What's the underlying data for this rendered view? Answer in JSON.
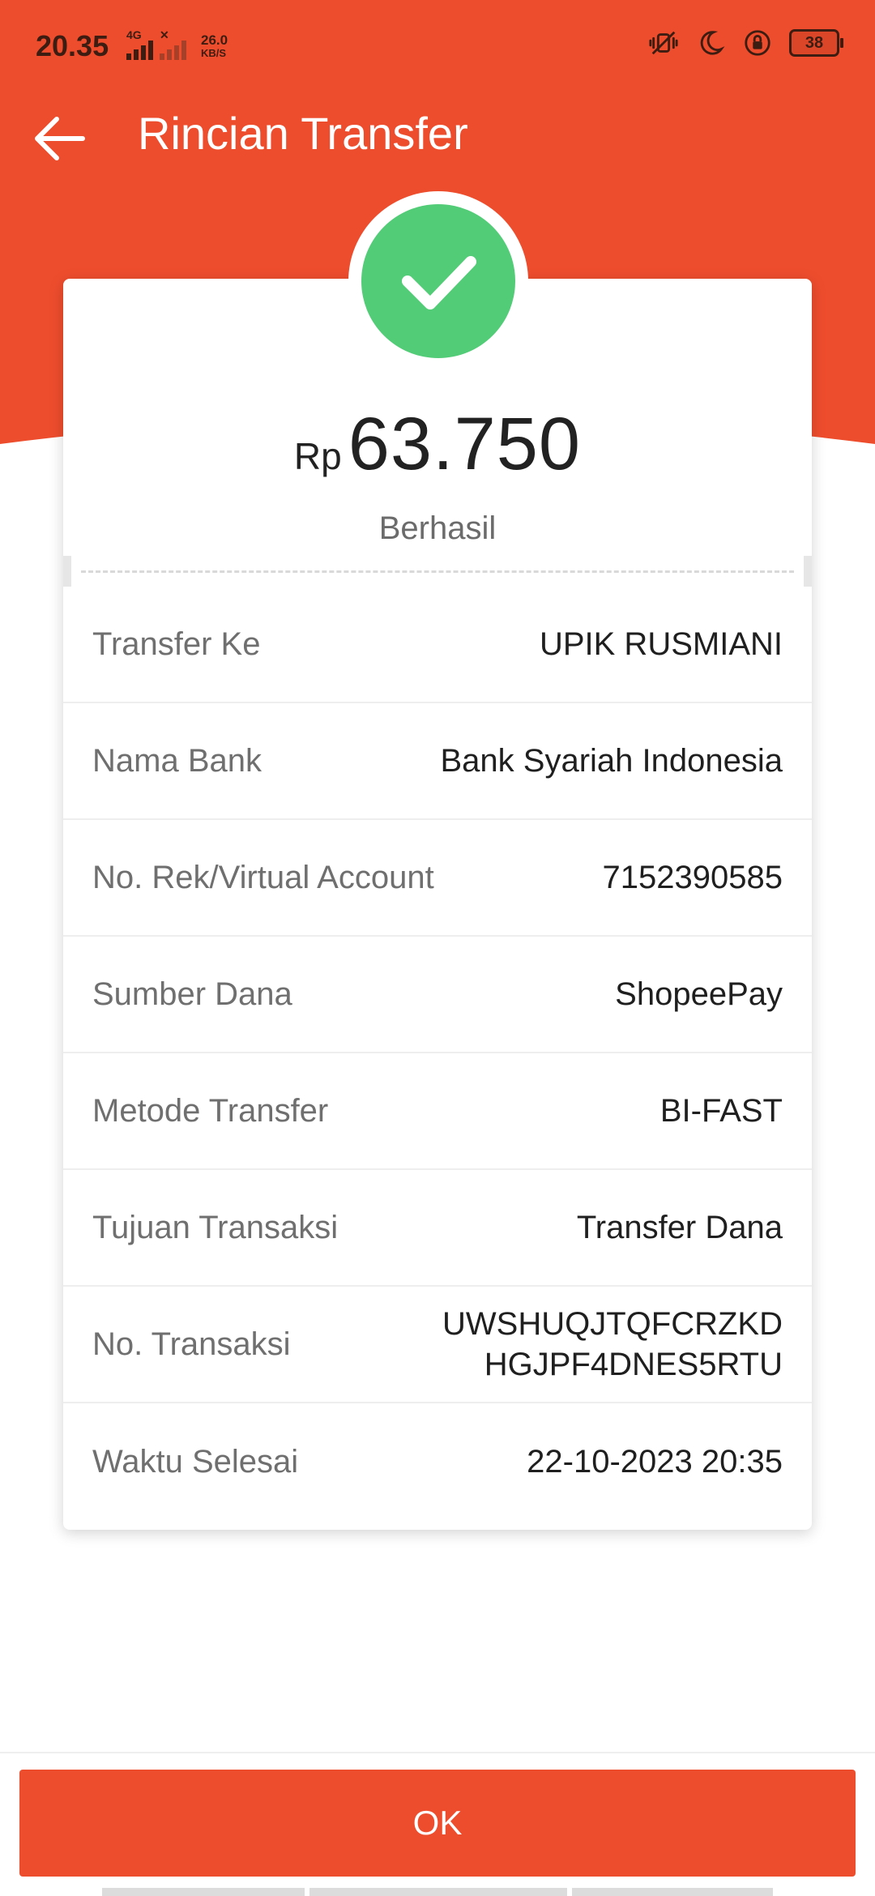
{
  "status_bar": {
    "time": "20.35",
    "network_type": "4G",
    "speed_value": "26.0",
    "speed_unit": "KB/S",
    "battery": "38"
  },
  "header": {
    "title": "Rincian Transfer"
  },
  "summary": {
    "currency": "Rp",
    "amount": "63.750",
    "status": "Berhasil"
  },
  "details": [
    {
      "label": "Transfer Ke",
      "value": "UPIK RUSMIANI"
    },
    {
      "label": "Nama Bank",
      "value": "Bank Syariah Indonesia"
    },
    {
      "label": "No. Rek/Virtual Account",
      "value": "7152390585"
    },
    {
      "label": "Sumber Dana",
      "value": "ShopeePay"
    },
    {
      "label": "Metode Transfer",
      "value": "BI-FAST"
    },
    {
      "label": "Tujuan Transaksi",
      "value": "Transfer Dana"
    },
    {
      "label": "No. Transaksi",
      "value_line1": "UWSHUQJTQFCRZKD",
      "value_line2": "HGJPF4DNES5RTU"
    },
    {
      "label": "Waktu Selesai",
      "value": "22-10-2023 20:35"
    }
  ],
  "footer": {
    "ok_label": "OK"
  },
  "colors": {
    "brand": "#ee4d2d",
    "success": "#52cc77"
  },
  "icons": {
    "back": "arrow-left-icon",
    "success": "check-icon"
  }
}
